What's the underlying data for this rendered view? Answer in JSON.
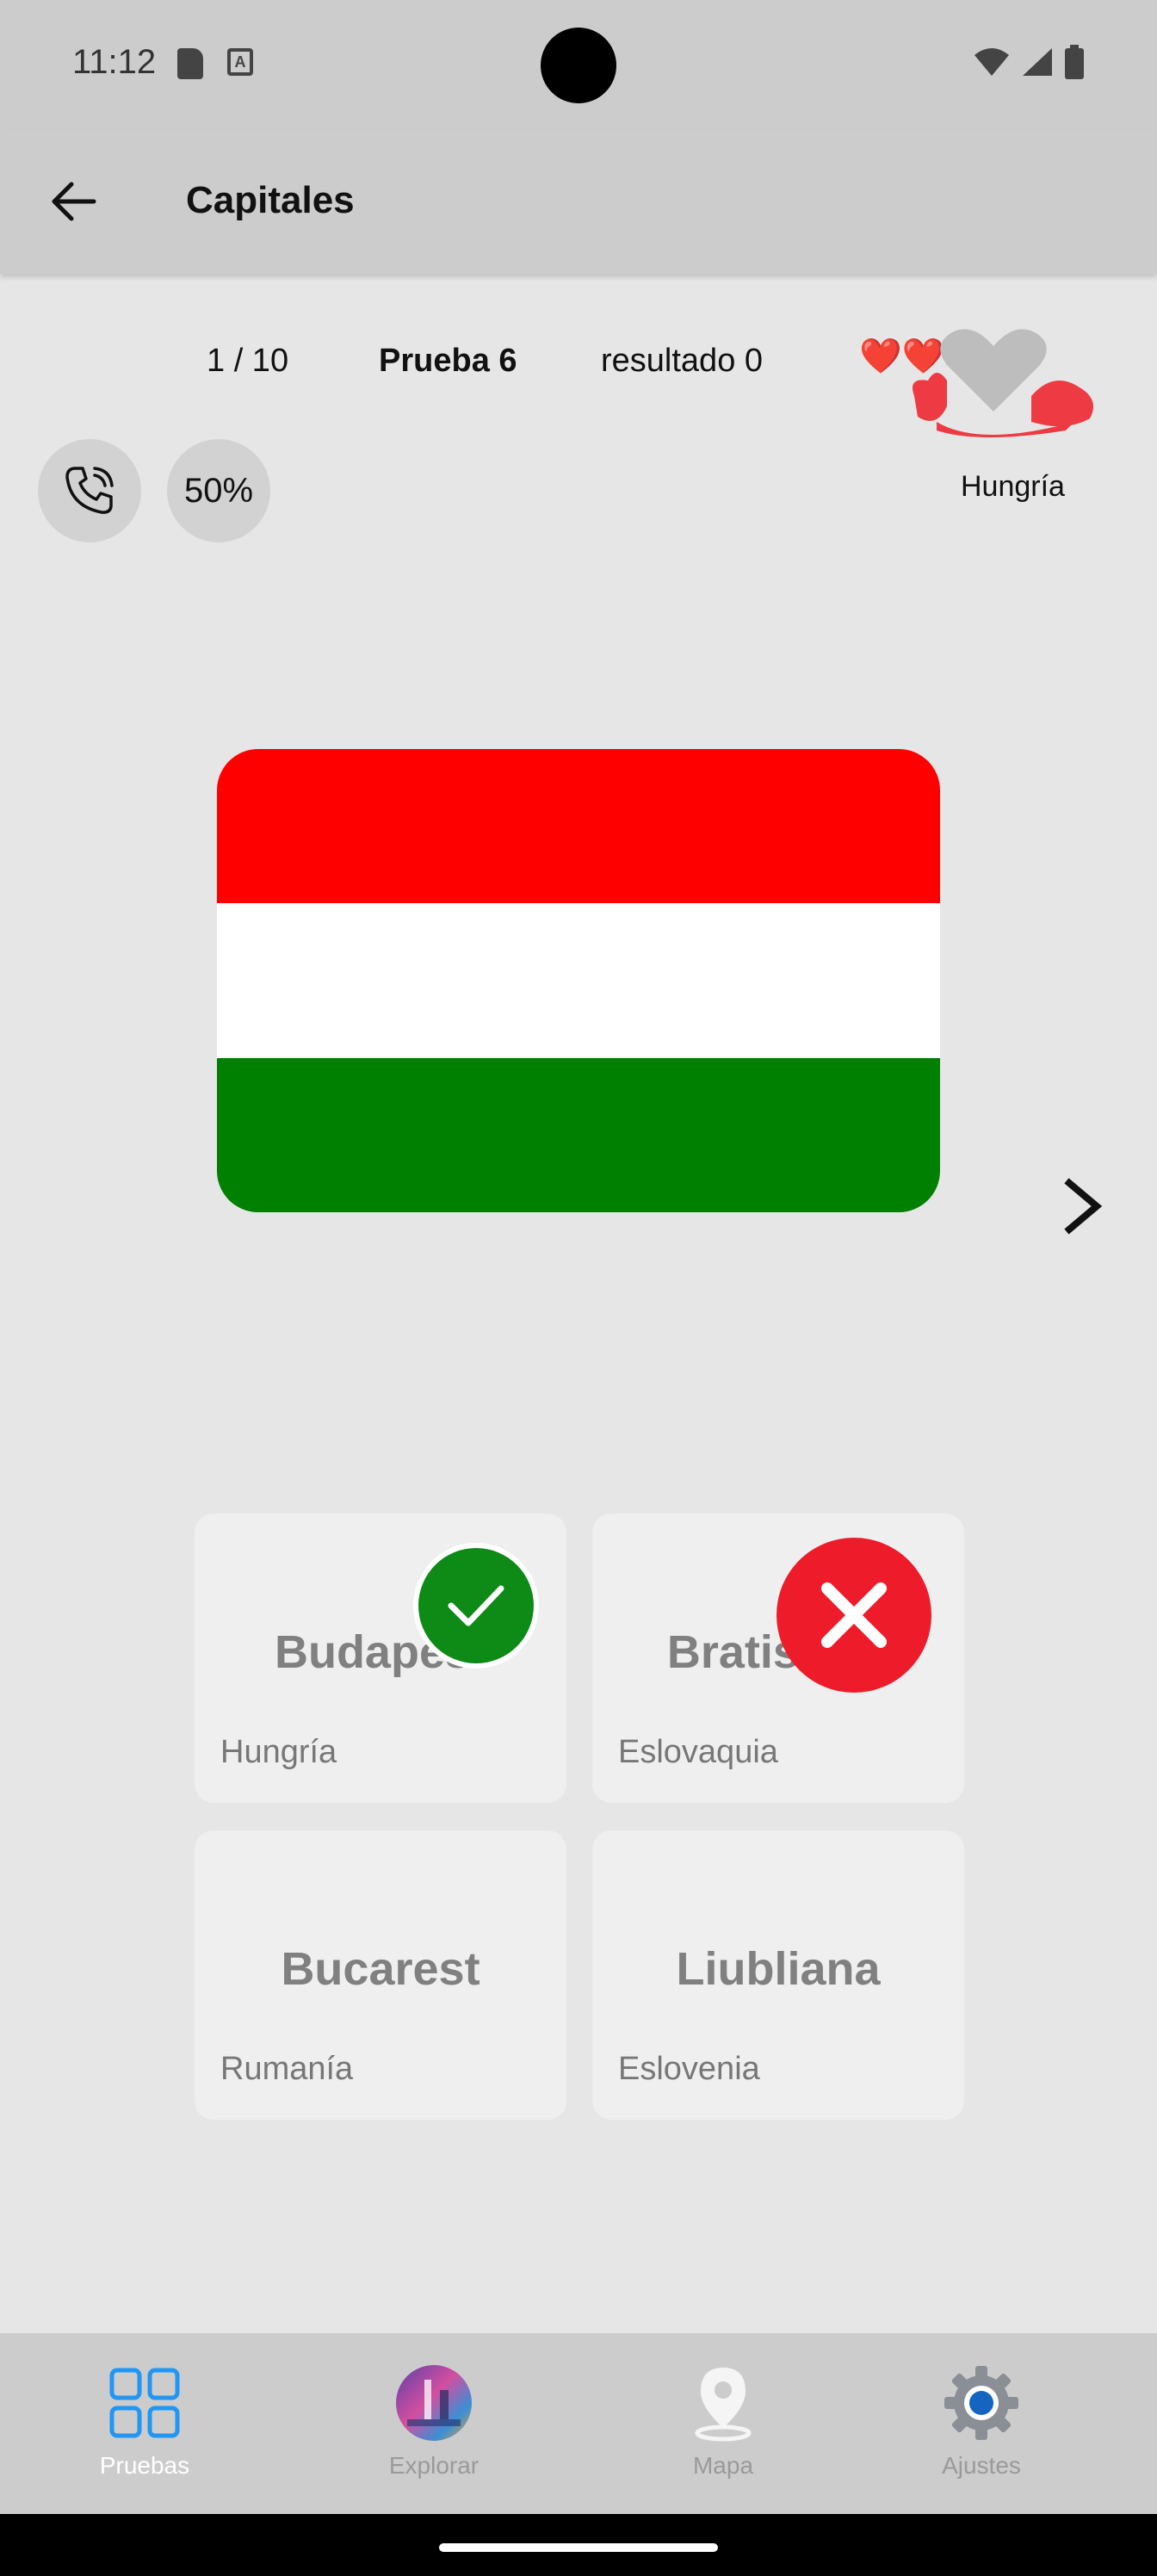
{
  "status_bar": {
    "time": "11:12",
    "a_icon_letter": "A",
    "icons": [
      "sd-card-icon",
      "a-notification-icon",
      "wifi-icon",
      "signal-icon",
      "battery-icon"
    ]
  },
  "app_bar": {
    "title": "Capitales",
    "back_icon": "arrow-left-icon"
  },
  "quiz_header": {
    "progress": "1 / 10",
    "test_name": "Prueba 6",
    "score": "resultado 0",
    "hearts_emoji": "❤️❤️",
    "country": "Hungría"
  },
  "lifelines": {
    "phone_icon": "phone-call-icon",
    "fifty_label": "50%"
  },
  "flag": {
    "colors": [
      "#ff0000",
      "#ffffff",
      "#008000"
    ]
  },
  "answers": [
    {
      "city": "Budapest",
      "country": "Hungría",
      "state": "correct"
    },
    {
      "city": "Bratislava",
      "country": "Eslovaquia",
      "state": "wrong"
    },
    {
      "city": "Bucarest",
      "country": "Rumanía",
      "state": "neutral"
    },
    {
      "city": "Liubliana",
      "country": "Eslovenia",
      "state": "neutral"
    }
  ],
  "bottom_nav": {
    "items": [
      {
        "label": "Pruebas",
        "icon": "grid-icon",
        "active": true
      },
      {
        "label": "Explorar",
        "icon": "globe-photo-icon",
        "active": false
      },
      {
        "label": "Mapa",
        "icon": "map-pin-icon",
        "active": false
      },
      {
        "label": "Ajustes",
        "icon": "gear-icon",
        "active": false
      }
    ]
  },
  "colors": {
    "accent_blue": "#2196f3",
    "correct_green": "#0e8a16",
    "wrong_red": "#ee1c2a"
  }
}
